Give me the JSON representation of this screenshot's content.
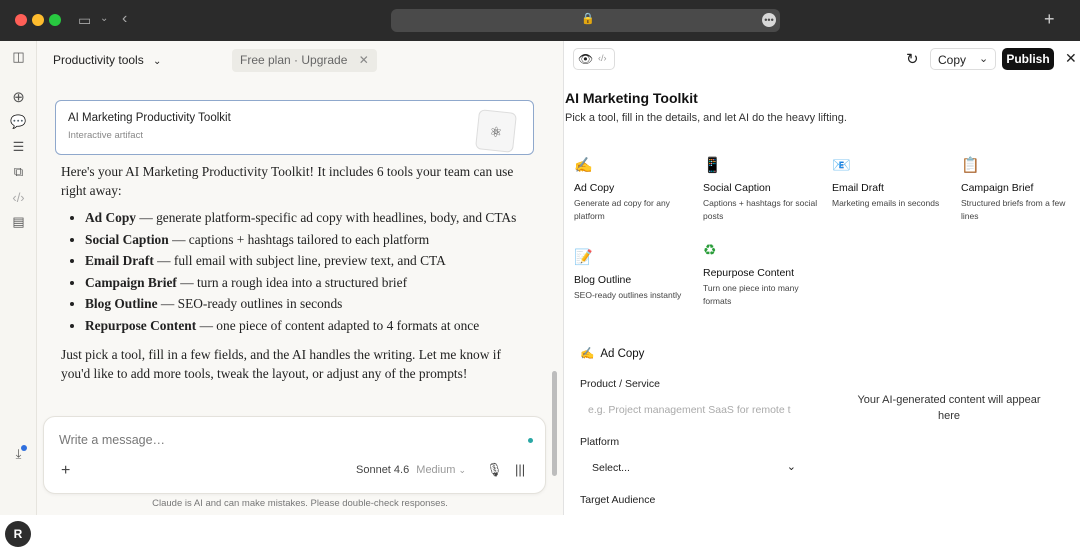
{
  "window": {
    "url_placeholder": ""
  },
  "chat": {
    "project_title": "Productivity tools",
    "plan_label": "Free plan · Upgrade",
    "artifact": {
      "title": "AI Marketing Productivity Toolkit",
      "subtitle": "Interactive artifact"
    },
    "intro": "Here's your AI Marketing Productivity Toolkit! It includes 6 tools your team can use right away:",
    "bullets": [
      {
        "name": "Ad Copy",
        "text": " — generate platform-specific ad copy with headlines, body, and CTAs"
      },
      {
        "name": "Social Caption",
        "text": " — captions + hashtags tailored to each platform"
      },
      {
        "name": "Email Draft",
        "text": " — full email with subject line, preview text, and CTA"
      },
      {
        "name": "Campaign Brief",
        "text": " — turn a rough idea into a structured brief"
      },
      {
        "name": "Blog Outline",
        "text": " — SEO-ready outlines in seconds"
      },
      {
        "name": "Repurpose Content",
        "text": " — one piece of content adapted to 4 formats at once"
      }
    ],
    "closing": "Just pick a tool, fill in a few fields, and the AI handles the writing. Let me know if you'd like to add more tools, tweak the layout, or adjust any of the prompts!",
    "input_placeholder": "Write a message…",
    "model": "Sonnet 4.6",
    "model_level": "Medium",
    "disclaimer": "Claude is AI and can make mistakes. Please double-check responses.",
    "avatar": "R"
  },
  "panel": {
    "copy_label": "Copy",
    "publish_label": "Publish",
    "title": "AI Marketing Toolkit",
    "subtitle": "Pick a tool, fill in the details, and let AI do the heavy lifting.",
    "tools": [
      {
        "icon": "✍",
        "name": "Ad Copy",
        "desc": "Generate ad copy for any platform"
      },
      {
        "icon": "📱",
        "name": "Social Caption",
        "desc": "Captions + hashtags for social posts"
      },
      {
        "icon": "📧",
        "name": "Email Draft",
        "desc": "Marketing emails in seconds"
      },
      {
        "icon": "📋",
        "name": "Campaign Brief",
        "desc": "Structured briefs from a few lines"
      },
      {
        "icon": "📝",
        "name": "Blog Outline",
        "desc": "SEO-ready outlines instantly"
      },
      {
        "icon": "♻",
        "name": "Repurpose Content",
        "desc": "Turn one piece into many formats"
      }
    ],
    "form": {
      "heading_icon": "✍",
      "heading": "Ad Copy",
      "product_label": "Product / Service",
      "product_placeholder": "e.g. Project management SaaS for remote t",
      "platform_label": "Platform",
      "platform_value": "Select...",
      "audience_label": "Target Audience"
    },
    "output_placeholder": "Your AI-generated content will appear here"
  }
}
